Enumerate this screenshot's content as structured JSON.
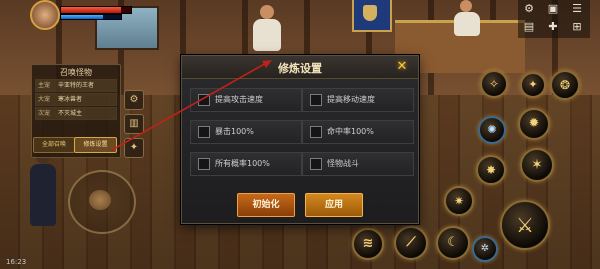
{
  "summon_panel": {
    "title": "召唤怪物",
    "rows": [
      {
        "key": "主宠",
        "value": "辛亚特的王者"
      },
      {
        "key": "大宠",
        "value": "寒冰兽者"
      },
      {
        "key": "次宠",
        "value": "不灭城主"
      }
    ],
    "button_all": "全部召唤",
    "button_settings": "修炼设置"
  },
  "dialog": {
    "title": "修炼设置",
    "options": [
      {
        "label": "提高攻击速度",
        "checked": false
      },
      {
        "label": "提高移动速度",
        "checked": false
      },
      {
        "label": "暴击100%",
        "checked": false
      },
      {
        "label": "命中率100%",
        "checked": false
      },
      {
        "label": "所有概率100%",
        "checked": false
      },
      {
        "label": "怪物战斗",
        "checked": false
      }
    ],
    "reset_label": "初始化",
    "apply_label": "应用"
  },
  "status": {
    "time": "16:23"
  },
  "colors": {
    "accent": "#f5c84a",
    "annotation": "#c0211a",
    "button_orange": "#c66a1a"
  },
  "icons": {
    "close": "close-icon",
    "settings": "gear-icon",
    "chart": "chart-icon",
    "star": "star-icon"
  }
}
